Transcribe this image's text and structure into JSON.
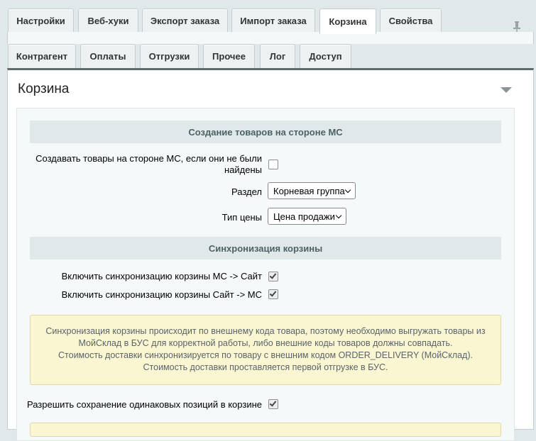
{
  "tabs_top": [
    {
      "label": "Настройки",
      "active": false
    },
    {
      "label": "Веб-хуки",
      "active": false
    },
    {
      "label": "Экспорт заказа",
      "active": false
    },
    {
      "label": "Импорт заказа",
      "active": false
    },
    {
      "label": "Корзина",
      "active": true
    },
    {
      "label": "Свойства",
      "active": false
    }
  ],
  "tabs_sub": [
    {
      "label": "Контрагент"
    },
    {
      "label": "Оплаты"
    },
    {
      "label": "Отгрузки"
    },
    {
      "label": "Прочее"
    },
    {
      "label": "Лог"
    },
    {
      "label": "Доступ"
    }
  ],
  "panel": {
    "title": "Корзина"
  },
  "section_create": {
    "heading": "Создание товаров на стороне МС",
    "create_label_line1": "Создавать товары на стороне МС, если они не были",
    "create_label_line2": "найдены",
    "create_checked": false,
    "section_label": "Раздел",
    "section_value": "Корневая группа",
    "price_label": "Тип цены",
    "price_value": "Цена продажи"
  },
  "section_sync": {
    "heading": "Синхронизация корзины",
    "sync_ms_site_label": "Включить синхронизацию корзины МС -> Сайт",
    "sync_ms_site_checked": true,
    "sync_site_ms_label": "Включить синхронизацию корзины Сайт -> МС",
    "sync_site_ms_checked": true,
    "note_lines": [
      "Синхронизация корзины происходит по внешнему кода товара, поэтому необходимо выгружать товары из",
      "МойСклад в БУС для корректной работы, либо внешние коды товаров должны совпадать.",
      "Стоимость доставки синхронизируется по товару с внешним кодом ORDER_DELIVERY (МойСклад).",
      "Стоимость доставки проставляется первой отгрузке в БУС."
    ],
    "allow_duplicates_label": "Разрешить сохранение одинаковых позиций в корзине",
    "allow_duplicates_checked": true
  },
  "colors": {
    "background": "#e0e8ea",
    "panel_border_top": "#5f6b6e",
    "section_heading_bg": "#e0e8ea",
    "section_heading_text": "#4b6267",
    "note_bg": "#fbf6d2"
  }
}
